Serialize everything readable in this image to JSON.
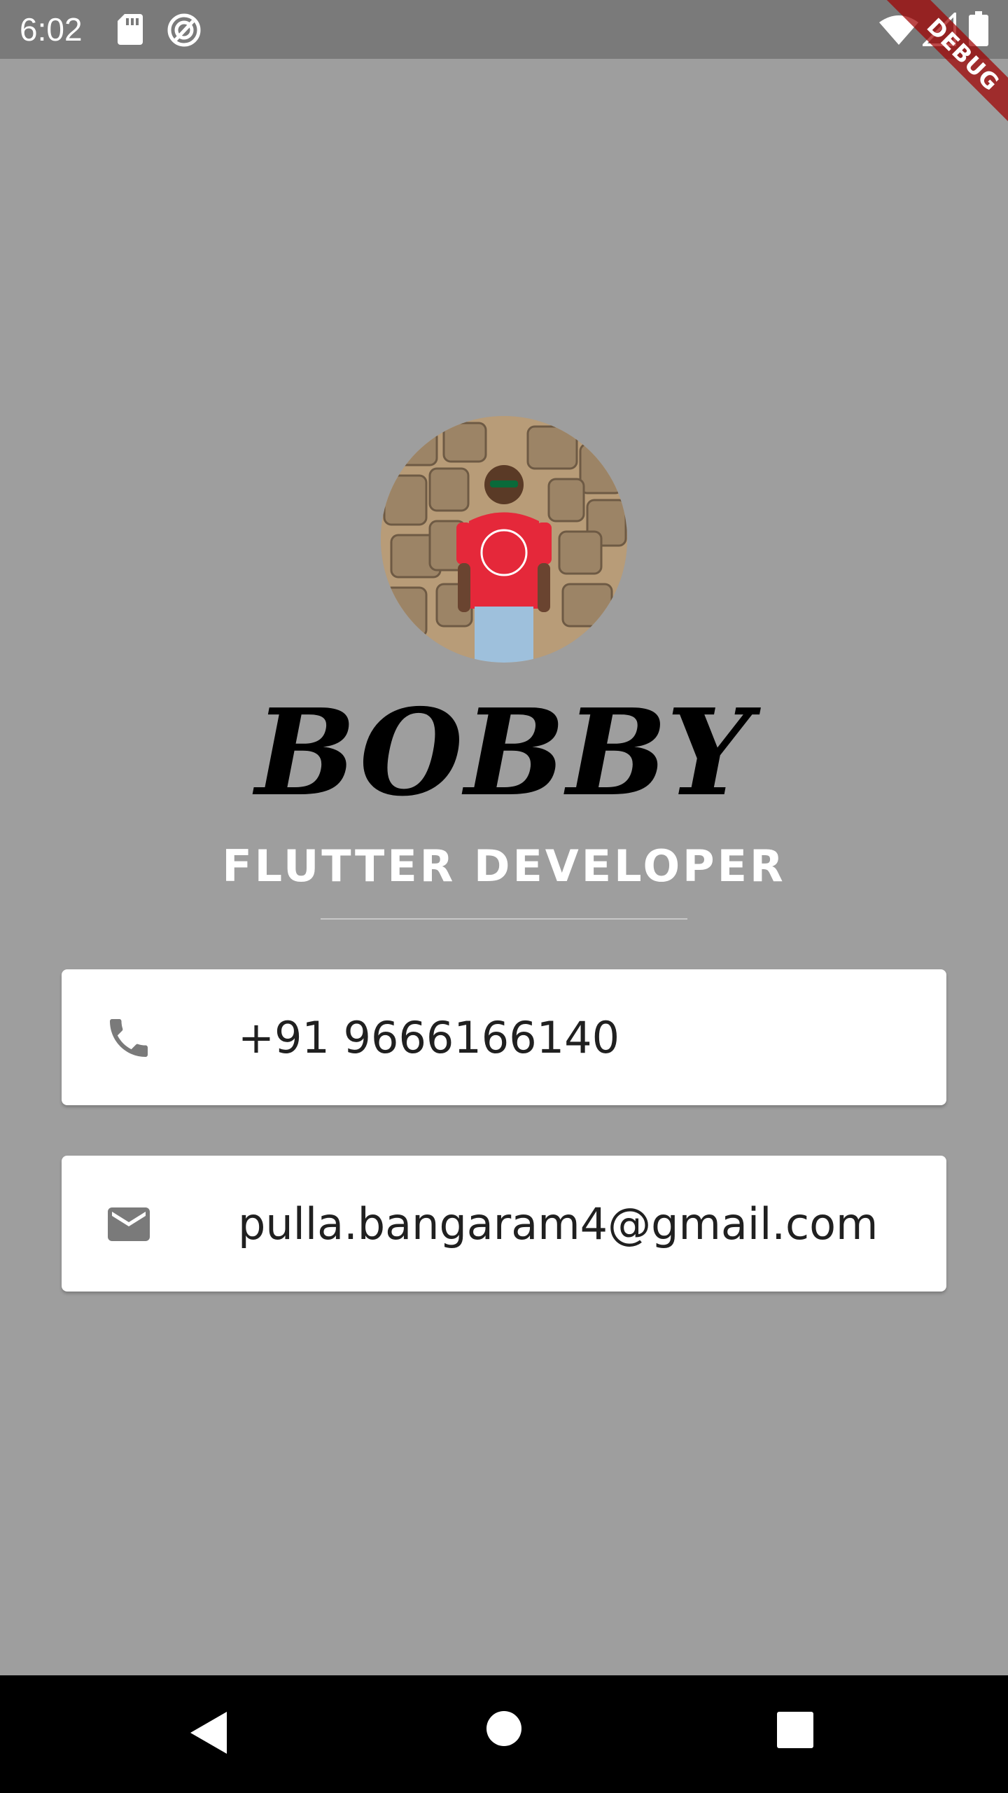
{
  "status_bar": {
    "time": "6:02",
    "icons": [
      "sd-card-icon",
      "sync-icon",
      "wifi-icon",
      "cell-signal-icon",
      "battery-icon"
    ]
  },
  "debug_banner": {
    "label": "DEBUG",
    "color": "#a00000"
  },
  "profile": {
    "name": "BOBBY",
    "title": "FLUTTER DEVELOPER",
    "avatar_icon": "profile-photo"
  },
  "contacts": {
    "phone": {
      "icon": "phone-icon",
      "value": "+91 9666166140"
    },
    "email": {
      "icon": "email-icon",
      "value": "pulla.bangaram4@gmail.com"
    }
  },
  "nav_bar": {
    "buttons": [
      "back-icon",
      "home-icon",
      "recents-icon"
    ]
  },
  "colors": {
    "background": "#9e9e9e",
    "status_bar": "#7a7a7a",
    "card": "#ffffff",
    "icon": "#7a7a7a"
  }
}
